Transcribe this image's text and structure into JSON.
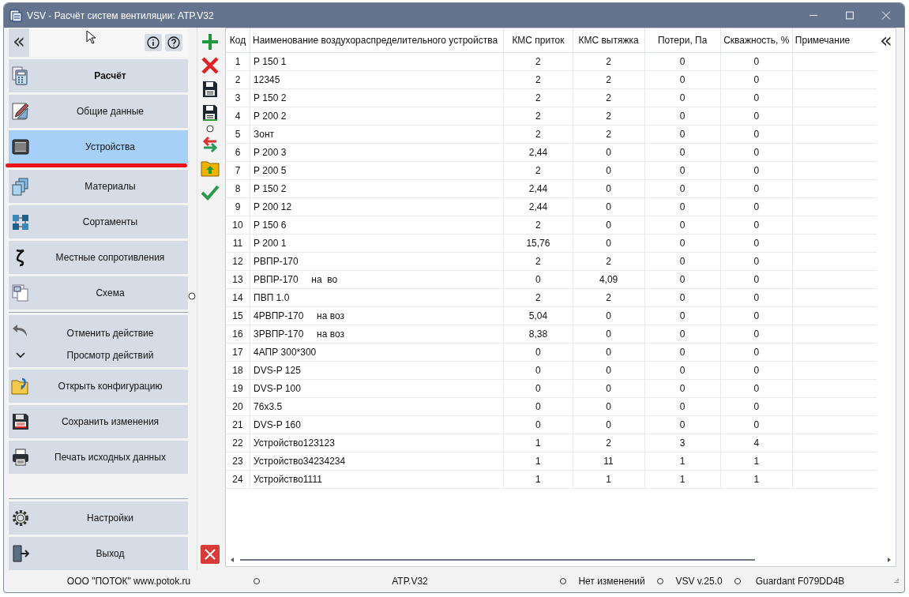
{
  "window": {
    "title": "VSV - Расчёт систем вентиляции: ATP.V32"
  },
  "sidebar": {
    "collapse_label": "«",
    "items": [
      {
        "kind": "nav",
        "label": "Расчёт",
        "bold": true,
        "selected": false
      },
      {
        "kind": "nav",
        "label": "Общие данные",
        "bold": false,
        "selected": false
      },
      {
        "kind": "nav",
        "label": "Устройства",
        "bold": false,
        "selected": true
      },
      {
        "kind": "nav",
        "label": "Материалы",
        "bold": false,
        "selected": false
      },
      {
        "kind": "nav",
        "label": "Сортаменты",
        "bold": false,
        "selected": false
      },
      {
        "kind": "nav",
        "label": "Местные сопротивления",
        "bold": false,
        "selected": false
      },
      {
        "kind": "nav",
        "label": "Схема",
        "bold": false,
        "selected": false
      },
      {
        "kind": "undo",
        "label": "Отменить действие",
        "sub_label": "Просмотр действий"
      },
      {
        "kind": "action",
        "label": "Открыть конфигурацию",
        "bold": false,
        "selected": false
      },
      {
        "kind": "action",
        "label": "Сохранить изменения",
        "bold": false,
        "selected": false
      },
      {
        "kind": "action",
        "label": "Печать исходных данных",
        "bold": false,
        "selected": false
      },
      {
        "kind": "spacer"
      },
      {
        "kind": "action",
        "label": "Настройки",
        "bold": false,
        "selected": false
      },
      {
        "kind": "action",
        "label": "Выход",
        "bold": false,
        "selected": false
      }
    ]
  },
  "table": {
    "collapse_label": "«",
    "columns": [
      "Код",
      "Наименование воздухораспределительного устройства",
      "КМС приток",
      "КМС вытяжка",
      "Потери, Па",
      "Скважность, %",
      "Примечание"
    ],
    "rows": [
      [
        "1",
        "Р 150 1",
        "2",
        "2",
        "0",
        "0"
      ],
      [
        "2",
        "12345",
        "2",
        "2",
        "0",
        "0"
      ],
      [
        "3",
        "Р 150 2",
        "2",
        "2",
        "0",
        "0"
      ],
      [
        "4",
        "Р 200 2",
        "2",
        "2",
        "0",
        "0"
      ],
      [
        "5",
        "Зонт",
        "2",
        "2",
        "0",
        "0"
      ],
      [
        "6",
        "Р 200 3",
        "2,44",
        "0",
        "0",
        "0"
      ],
      [
        "7",
        "Р 200 5",
        "2",
        "0",
        "0",
        "0"
      ],
      [
        "8",
        "Р 150 2",
        "2,44",
        "0",
        "0",
        "0"
      ],
      [
        "9",
        "Р 200 12",
        "2,44",
        "0",
        "0",
        "0"
      ],
      [
        "10",
        "Р 150 6",
        "2",
        "0",
        "0",
        "0"
      ],
      [
        "11",
        "Р 200 1",
        "15,76",
        "0",
        "0",
        "0"
      ],
      [
        "12",
        "РВПР-170",
        "2",
        "2",
        "0",
        "0"
      ],
      [
        "13",
        "РВПР-170     на  во",
        "0",
        "4,09",
        "0",
        "0"
      ],
      [
        "14",
        "ПВП 1.0",
        "2",
        "2",
        "0",
        "0"
      ],
      [
        "15",
        "4РВПР-170     на воз",
        "5,04",
        "0",
        "0",
        "0"
      ],
      [
        "16",
        "3РВПР-170     на воз",
        "8,38",
        "0",
        "0",
        "0"
      ],
      [
        "17",
        "4АПР 300*300",
        "0",
        "0",
        "0",
        "0"
      ],
      [
        "18",
        "DVS-P 125",
        "0",
        "0",
        "0",
        "0"
      ],
      [
        "19",
        "DVS-P 100",
        "0",
        "0",
        "0",
        "0"
      ],
      [
        "20",
        "76x3.5",
        "0",
        "0",
        "0",
        "0"
      ],
      [
        "21",
        "DVS-P 160",
        "0",
        "0",
        "0",
        "0"
      ],
      [
        "22",
        "Устройство123123",
        "1",
        "2",
        "3",
        "4"
      ],
      [
        "23",
        "Устройство34234234",
        "1",
        "11",
        "1",
        "1"
      ],
      [
        "24",
        "Устройство1111",
        "1",
        "1",
        "1",
        "1"
      ]
    ]
  },
  "status_bar": [
    "ООО \"ПОТОК\" www.potok.ru",
    "ATP.V32",
    "Нет изменений",
    "VSV v.25.0",
    "Guardant F079DD4B"
  ]
}
